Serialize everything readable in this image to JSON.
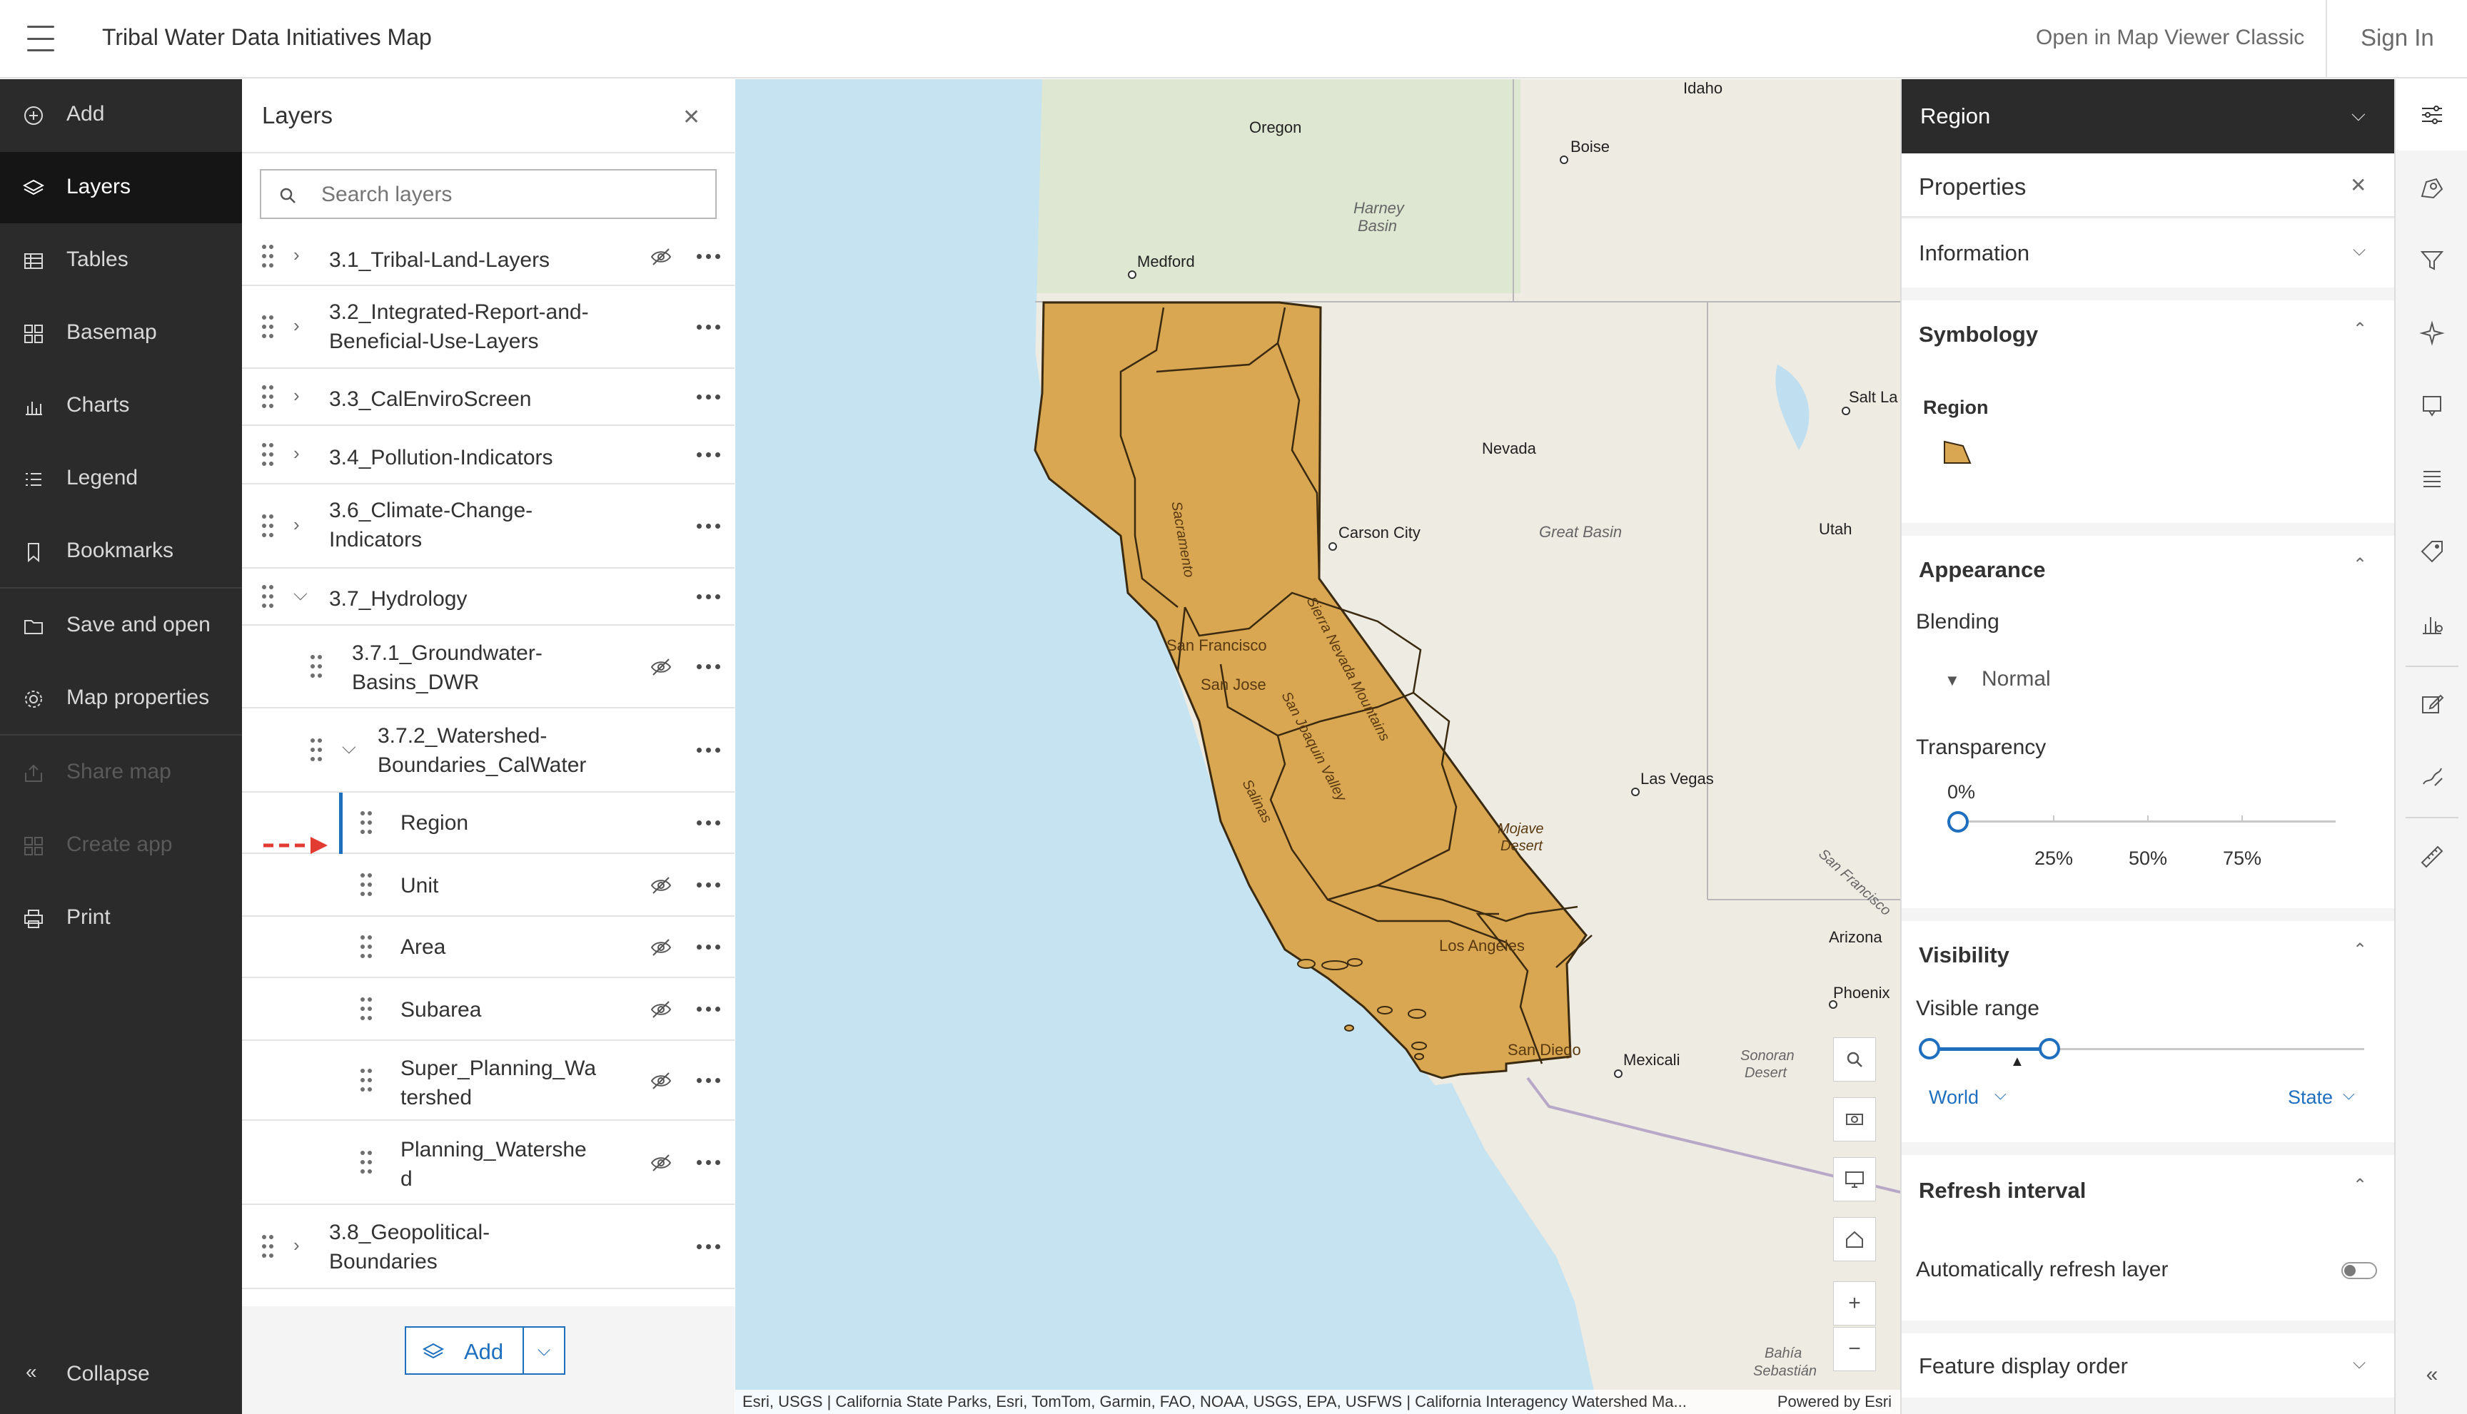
{
  "header": {
    "title": "Tribal Water Data Initiatives Map",
    "open_classic": "Open in Map Viewer Classic",
    "sign_in": "Sign In"
  },
  "leftnav": {
    "items": [
      {
        "label": "Add",
        "icon": "plus-circle-icon"
      },
      {
        "label": "Layers",
        "icon": "layers-icon"
      },
      {
        "label": "Tables",
        "icon": "table-icon"
      },
      {
        "label": "Basemap",
        "icon": "basemap-icon"
      },
      {
        "label": "Charts",
        "icon": "chart-icon"
      },
      {
        "label": "Legend",
        "icon": "legend-icon"
      },
      {
        "label": "Bookmarks",
        "icon": "bookmark-icon"
      },
      {
        "label": "Save and open",
        "icon": "folder-icon"
      },
      {
        "label": "Map properties",
        "icon": "gear-icon"
      },
      {
        "label": "Share map",
        "icon": "share-icon"
      },
      {
        "label": "Create app",
        "icon": "apps-icon"
      },
      {
        "label": "Print",
        "icon": "print-icon"
      }
    ],
    "collapse": "Collapse"
  },
  "layers_panel": {
    "title": "Layers",
    "search_placeholder": "Search layers",
    "layers": [
      {
        "name": "3.1_Tribal-Land-Layers"
      },
      {
        "name1": "3.2_Integrated-Report-and-",
        "name2": "Beneficial-Use-Layers"
      },
      {
        "name": "3.3_CalEnviroScreen"
      },
      {
        "name": "3.4_Pollution-Indicators"
      },
      {
        "name1": "3.6_Climate-Change-",
        "name2": "Indicators"
      },
      {
        "name": "3.7_Hydrology"
      },
      {
        "name1": "3.7.1_Groundwater-",
        "name2": "Basins_DWR"
      },
      {
        "name1": "3.7.2_Watershed-",
        "name2": "Boundaries_CalWater"
      },
      {
        "name": "Region"
      },
      {
        "name": "Unit"
      },
      {
        "name": "Area"
      },
      {
        "name": "Subarea"
      },
      {
        "name1": "Super_Planning_Wa",
        "name2": "tershed"
      },
      {
        "name1": "Planning_Watershe",
        "name2": "d"
      },
      {
        "name1": "3.8_Geopolitical-",
        "name2": "Boundaries"
      }
    ],
    "add_button": "Add"
  },
  "map": {
    "labels": {
      "oregon": "Oregon",
      "idaho": "Idaho",
      "boise": "Boise",
      "harney": "Harney",
      "basin": "Basin",
      "medford": "Medford",
      "salt_lake": "Salt La",
      "nevada": "Nevada",
      "carson": "Carson City",
      "great_basin": "Great Basin",
      "utah": "Utah",
      "sacramento": "Sacramento",
      "san_francisco": "San Francisco",
      "san_jose": "San Jose",
      "sierra": "Sierra Nevada Mountains",
      "san_joaquin": "San Joaquin Valley",
      "salinas": "Salinas",
      "las_vegas": "Las Vegas",
      "mojave1": "Mojave",
      "mojave2": "Desert",
      "san_francisco_peaks": "San Francisco",
      "arizona": "Arizona",
      "los_angeles": "Los Angeles",
      "phoenix": "Phoenix",
      "san_diego": "San Diego",
      "mexicali": "Mexicali",
      "sonoran1": "Sonoran",
      "sonoran2": "Desert",
      "bahia1": "Bahía",
      "bahia2": "Sebastián"
    },
    "attribution": "Esri, USGS | California State Parks, Esri, TomTom, Garmin, FAO, NOAA, USGS, EPA, USFWS | California Interagency Watershed Ma...",
    "powered": "Powered by Esri",
    "colors": {
      "water": "#c6e3f2",
      "region_fill": "#d9a652",
      "land": "#f2f0ea"
    }
  },
  "properties": {
    "layer_selector": "Region",
    "title": "Properties",
    "information": "Information",
    "symbology": "Symbology",
    "symbol_label": "Region",
    "appearance": "Appearance",
    "blending": "Blending",
    "blending_value": "Normal",
    "transparency": "Transparency",
    "transparency_value": "0%",
    "transparency_ticks": [
      "25%",
      "50%",
      "75%"
    ],
    "transparency_level": 0,
    "visibility": "Visibility",
    "visible_range": "Visible range",
    "range_min": "World",
    "range_max": "State",
    "refresh_interval": "Refresh interval",
    "auto_refresh": "Automatically refresh layer",
    "auto_refresh_on": false,
    "feature_display_order": "Feature display order"
  },
  "rightbar": {
    "icons": [
      "properties-icon",
      "styles-icon",
      "filter-icon",
      "effects-icon",
      "popups-icon",
      "fields-icon",
      "labels-icon",
      "configure-charts-icon",
      "edit-icon",
      "sketch-icon",
      "measure-icon",
      "collapse-icon"
    ]
  }
}
